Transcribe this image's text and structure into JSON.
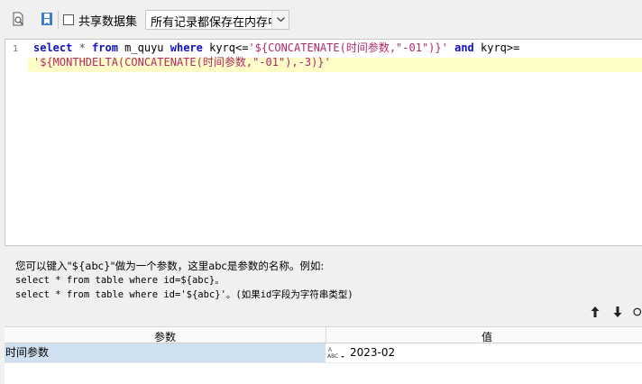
{
  "toolbar": {
    "preview_icon": "search-document-icon",
    "save_icon": "bookmark-icon",
    "share_label": "共享数据集",
    "share_checked": false,
    "cache_mode": "所有记录都保存在内存中"
  },
  "editor": {
    "line_number": "1",
    "sql": {
      "t1": "select",
      "t2": " * ",
      "t3": "from",
      "t4": " m_quyu ",
      "t5": "where",
      "t6": " kyrq<=",
      "t7": "'${CONCATENATE(时间参数,\"-01\")}'",
      "t8": " ",
      "t9": "and",
      "t10": " kyrq>=",
      "t11": "'${MONTHDELTA(CONCATENATE(时间参数,\"-01\"),-3)}'"
    }
  },
  "help": {
    "line1": "您可以键入\"${abc}\"做为一个参数，这里abc是参数的名称。例如:",
    "line2": "select * from table where id=${abc}。",
    "line3": "select * from table where id='${abc}'。(如果id字段为字符串类型)"
  },
  "params_table": {
    "col_name": "参数",
    "col_value": "值",
    "rows": [
      {
        "name": "时间参数",
        "type_icon": "string-type-icon",
        "value": "2023-02"
      }
    ]
  }
}
